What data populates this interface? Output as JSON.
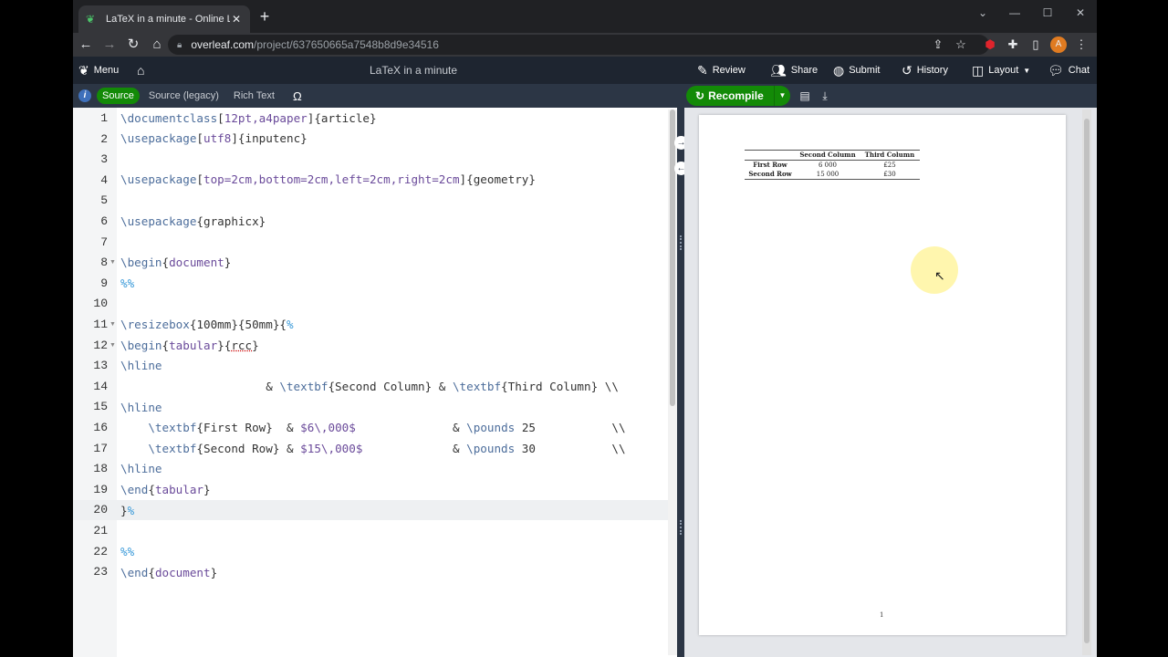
{
  "browser": {
    "tab_title": "LaTeX in a minute - Online LaTeX",
    "tab_close": "✕",
    "new_tab": "+",
    "url_host": "overleaf.com",
    "url_path": "/project/637650665a7548b8d9e34516",
    "profile_initial": "A"
  },
  "toolbar": {
    "menu": "Menu",
    "project_title": "LaTeX in a minute",
    "review": "Review",
    "share": "Share",
    "submit": "Submit",
    "history": "History",
    "layout": "Layout",
    "chat": "Chat"
  },
  "editor_toolbar": {
    "info": "i",
    "source": "Source",
    "source_legacy": "Source (legacy)",
    "rich_text": "Rich Text",
    "symbol": "Ω"
  },
  "pdf_toolbar": {
    "recompile": "Recompile"
  },
  "editor": {
    "current_line": 20,
    "lines": [
      {
        "n": "1"
      },
      {
        "n": "2"
      },
      {
        "n": "3"
      },
      {
        "n": "4"
      },
      {
        "n": "5"
      },
      {
        "n": "6"
      },
      {
        "n": "7"
      },
      {
        "n": "8"
      },
      {
        "n": "9"
      },
      {
        "n": "10"
      },
      {
        "n": "11"
      },
      {
        "n": "12"
      },
      {
        "n": "13"
      },
      {
        "n": "14"
      },
      {
        "n": "15"
      },
      {
        "n": "16"
      },
      {
        "n": "17"
      },
      {
        "n": "18"
      },
      {
        "n": "19"
      },
      {
        "n": "20"
      },
      {
        "n": "21"
      },
      {
        "n": "22"
      },
      {
        "n": "23"
      }
    ]
  },
  "pdf": {
    "table": {
      "header": [
        "",
        "Second Column",
        "Third Column"
      ],
      "rows": [
        [
          "First Row",
          "6 000",
          "£25"
        ],
        [
          "Second Row",
          "15 000",
          "£30"
        ]
      ]
    },
    "page_number": "1"
  },
  "colors": {
    "accent_green": "#138a07",
    "toolbar_dark": "#1e2530",
    "toolbar_mid": "#2c3645"
  }
}
